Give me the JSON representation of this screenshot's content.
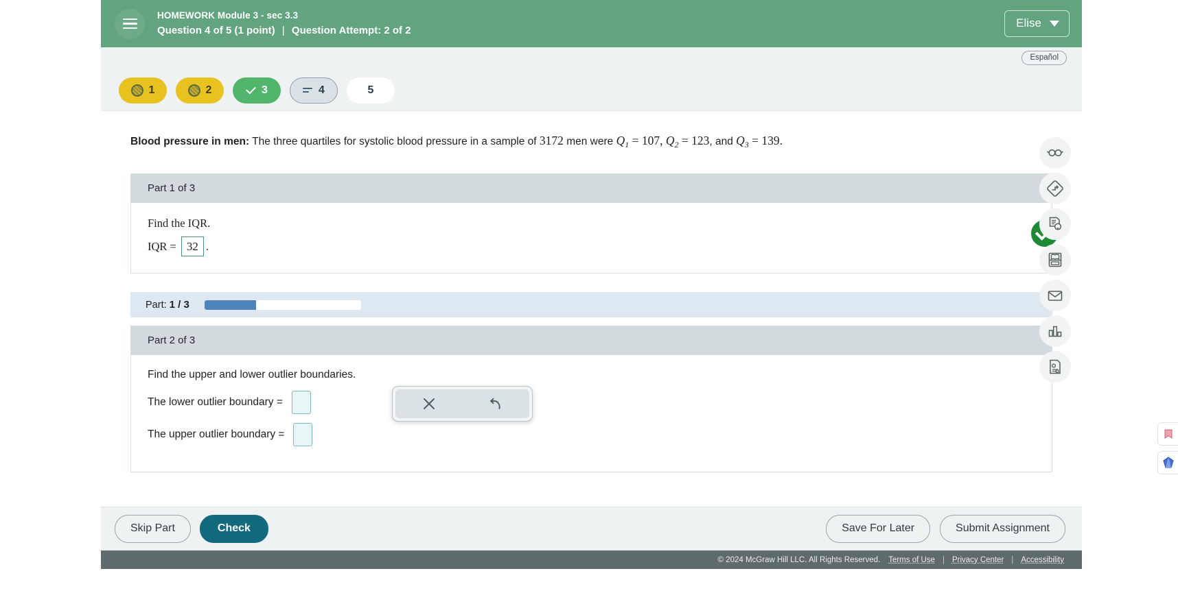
{
  "header": {
    "menu_icon": "hamburger-icon",
    "assignment_title": "HOMEWORK Module 3 - sec 3.3",
    "question_label": "Question 4 of 5 (1 point)",
    "separator": "|",
    "attempt_label": "Question Attempt: 2 of 2",
    "user_name": "Elise",
    "caret_icon": "chevron-down-icon",
    "brand_color": "#61a47f"
  },
  "language": {
    "button_label": "Español"
  },
  "question_pills": [
    {
      "number": "1",
      "state": "partial",
      "icon": "hatched-circle-icon"
    },
    {
      "number": "2",
      "state": "partial",
      "icon": "hatched-circle-icon"
    },
    {
      "number": "3",
      "state": "correct",
      "icon": "check-icon"
    },
    {
      "number": "4",
      "state": "current",
      "icon": "lines-icon"
    },
    {
      "number": "5",
      "state": "blank",
      "icon": ""
    }
  ],
  "question": {
    "title": "Blood pressure in men:",
    "text_1": "The three quartiles for systolic blood pressure in a sample of ",
    "sample_size": "3172",
    "text_2": " men were ",
    "q1_var": "Q",
    "q1_sub": "1",
    "q1_eq": " = ",
    "q1_value": "107",
    "comma_1": ", ",
    "q2_var": "Q",
    "q2_sub": "2",
    "q2_eq": " = ",
    "q2_value": "123",
    "comma_2": ",  and ",
    "q3_var": "Q",
    "q3_sub": "3",
    "q3_eq": " = ",
    "q3_value": "139",
    "period": "."
  },
  "part1": {
    "heading": "Part 1 of 3",
    "prompt": "Find the IQR.",
    "answer_label": "IQR = ",
    "answer_value": "32",
    "trailing": ".",
    "status_icon": "check-circle-icon",
    "status": "correct"
  },
  "part_progress": {
    "label": "Part:",
    "value": "1 / 3",
    "percent": 33,
    "fill_color": "#4e83bb"
  },
  "part2": {
    "heading": "Part 2 of 3",
    "prompt": "Find the upper and lower outlier boundaries.",
    "lower_label": "The lower outlier boundary =",
    "lower_value": "",
    "upper_label": "The upper outlier boundary =",
    "upper_value": ""
  },
  "tool_popup": {
    "clear_icon": "close-x-icon",
    "undo_icon": "undo-arrow-icon",
    "clear_label": "",
    "undo_label": ""
  },
  "tool_rail": [
    {
      "icon": "reading-glasses-icon",
      "name": "tool-reader"
    },
    {
      "icon": "guided-sign-icon",
      "name": "tool-guided-solution"
    },
    {
      "icon": "hint-document-icon",
      "name": "tool-hint"
    },
    {
      "icon": "ebook-icon",
      "name": "tool-ebook"
    },
    {
      "icon": "mail-envelope-icon",
      "name": "tool-message-instructor"
    },
    {
      "icon": "bar-chart-icon",
      "name": "tool-statistics"
    },
    {
      "icon": "calculator-document-icon",
      "name": "tool-calculator"
    }
  ],
  "actions": {
    "skip_part": "Skip Part",
    "check": "Check",
    "save_for_later": "Save For Later",
    "submit_assignment": "Submit Assignment",
    "primary_color": "#136a7f"
  },
  "footer": {
    "copyright": "© 2024 McGraw Hill LLC. All Rights Reserved.",
    "terms": "Terms of Use",
    "sep1": "|",
    "privacy": "Privacy Center",
    "sep2": "|",
    "accessibility": "Accessibility"
  }
}
